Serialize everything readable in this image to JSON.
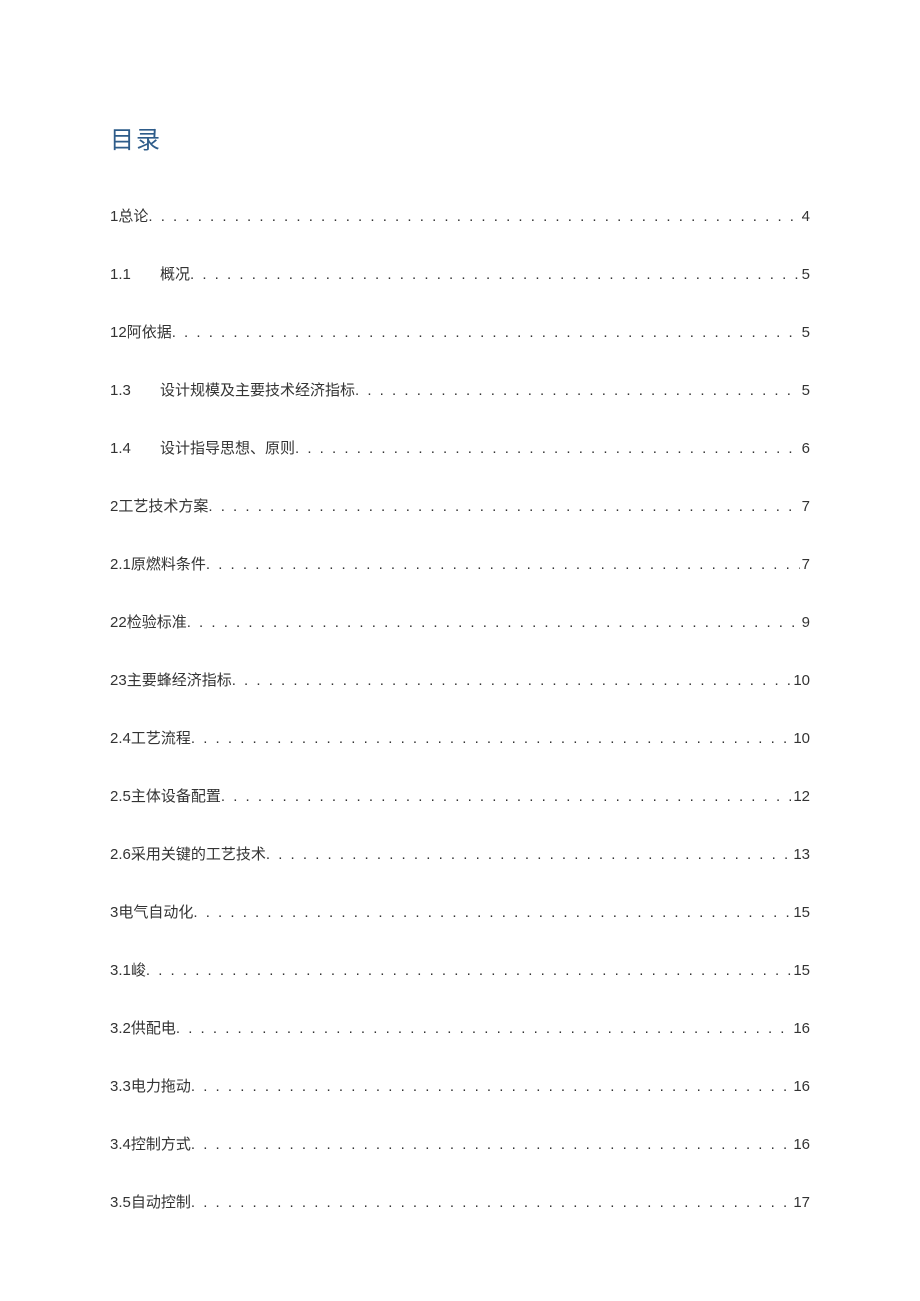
{
  "title": "目录",
  "entries": [
    {
      "num": "1 ",
      "numClass": "",
      "text": "总论",
      "page": "4"
    },
    {
      "num": "1.1",
      "numClass": "wide",
      "text": "概况",
      "page": "5"
    },
    {
      "num": "12 ",
      "numClass": "",
      "text": "阿依据",
      "page": "5"
    },
    {
      "num": "1.3",
      "numClass": "wide",
      "text": "设计规模及主要技术经济指标",
      "page": "5"
    },
    {
      "num": "1.4",
      "numClass": "wide",
      "text": "设计指导思想、原则",
      "page": "6"
    },
    {
      "num": "2 ",
      "numClass": "",
      "text": "工艺技术方案",
      "page": "7"
    },
    {
      "num": "2.1  ",
      "numClass": "",
      "text": "原燃料条件 ",
      "page": "7"
    },
    {
      "num": "22 ",
      "numClass": "",
      "text": "检验标准",
      "page": "9"
    },
    {
      "num": "23 ",
      "numClass": "",
      "text": "主要蜂经济指标",
      "page": "10"
    },
    {
      "num": "2.4  ",
      "numClass": "",
      "text": "工艺流程 ",
      "page": "10"
    },
    {
      "num": "2.5  ",
      "numClass": "",
      "text": "主体设备配置 ",
      "page": "12"
    },
    {
      "num": "2.6  ",
      "numClass": "",
      "text": "采用关键的工艺技术 ",
      "page": "13"
    },
    {
      "num": "3 ",
      "numClass": "",
      "text": "电气自动化",
      "page": "15"
    },
    {
      "num": "3.1  ",
      "numClass": "",
      "text": "峻 ",
      "page": "15"
    },
    {
      "num": "3.2  ",
      "numClass": "",
      "text": " 供配电",
      "page": "16"
    },
    {
      "num": "3.3  ",
      "numClass": "",
      "text": " 电力拖动 ",
      "page": "16"
    },
    {
      "num": "3.4  ",
      "numClass": "",
      "text": "控制方式 ",
      "page": "16"
    },
    {
      "num": "3.5  ",
      "numClass": "",
      "text": " 自动控制 ",
      "page": "17"
    }
  ]
}
